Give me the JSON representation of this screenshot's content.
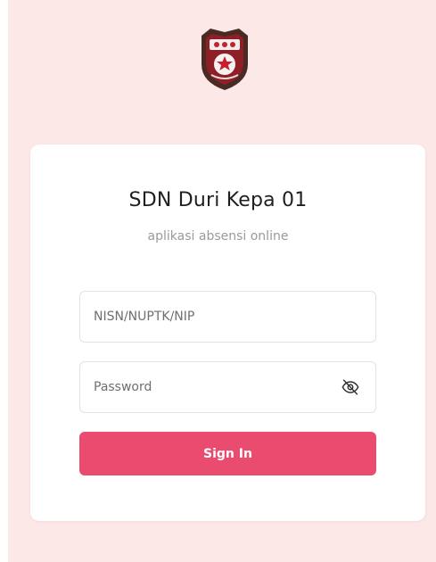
{
  "brand": {
    "logo_icon": "school-crest-icon",
    "background_color": "#fde8e8",
    "accent_color": "#e94c6f"
  },
  "login": {
    "title": "SDN Duri Kepa 01",
    "subtitle": "aplikasi absensi online",
    "id_field": {
      "placeholder": "NISN/NUPTK/NIP",
      "value": ""
    },
    "password_field": {
      "placeholder": "Password",
      "value": "",
      "toggle_icon": "eye-off-icon"
    },
    "submit_label": "Sign In"
  }
}
